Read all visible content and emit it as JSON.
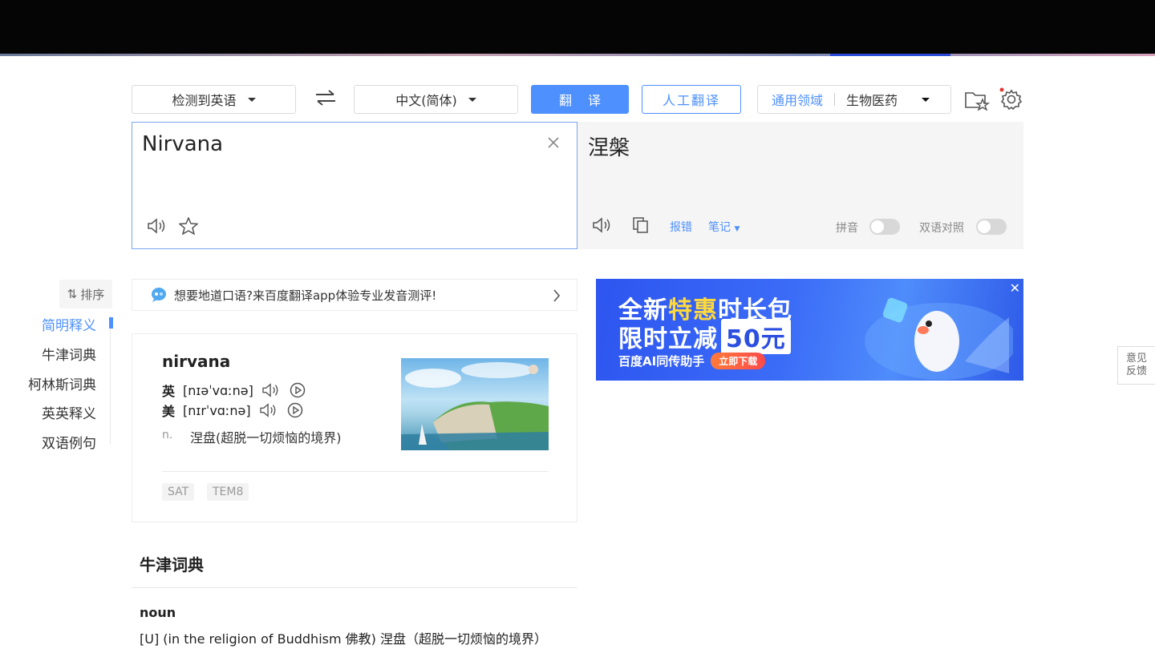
{
  "toolbar": {
    "source_lang": "检测到英语",
    "target_lang": "中文(简体)",
    "translate_label": "翻译",
    "human_translate_label": "人工翻译",
    "domain_general": "通用领域",
    "domain_selected": "生物医药"
  },
  "input": {
    "text": "Nirvana"
  },
  "output": {
    "text": "涅槃",
    "report_error": "报错",
    "notes": "笔记",
    "pinyin_label": "拼音",
    "bilingual_label": "双语对照"
  },
  "sidebar": {
    "sort_label": "排序",
    "items": [
      {
        "label": "简明释义"
      },
      {
        "label": "牛津词典"
      },
      {
        "label": "柯林斯词典"
      },
      {
        "label": "英英释义"
      },
      {
        "label": "双语例句"
      }
    ]
  },
  "promo": {
    "text": "想要地道口语?来百度翻译app体验专业发音测评!"
  },
  "ad": {
    "line1_a": "全新",
    "line1_b": "特惠",
    "line1_c": "时长包",
    "line2_a": "限时立减",
    "line2_b": "50元",
    "brand": "百度AI同传助手",
    "cta": "立即下载"
  },
  "dict": {
    "word": "nirvana",
    "uk_label": "英",
    "uk_phonetic": "[nɪəˈvɑːnə]",
    "us_label": "美",
    "us_phonetic": "[nɪrˈvɑːnə]",
    "pos": "n.",
    "definition": "涅盘(超脱一切烦恼的境界)",
    "tags": [
      "SAT",
      "TEM8"
    ]
  },
  "oxford": {
    "title": "牛津词典",
    "pos": "noun",
    "definition": "[U] (in the religion of Buddhism 佛教) 涅盘（超脱一切烦恼的境界）"
  },
  "feedback": {
    "line1": "意见",
    "line2": "反馈"
  },
  "colors": {
    "accent": "#4d90fe",
    "ad_bg": "#3b6cf7"
  }
}
